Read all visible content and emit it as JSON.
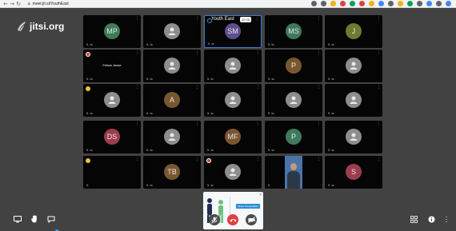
{
  "browser": {
    "url": "meet.jit.si/YouthEast",
    "nav": {
      "back": "←",
      "forward": "→",
      "reload": "↻"
    },
    "lock_icon": "lock-icon",
    "extension_colors": [
      "#5f6368",
      "#5f6368",
      "#f4b400",
      "#db4437",
      "#0f9d58",
      "#db4437",
      "#f4b400",
      "#4285f4",
      "#5f6368",
      "#f4b400",
      "#0f9d58",
      "#5f6368",
      "#4285f4",
      "#5f6368",
      "#4285f4"
    ]
  },
  "logo": {
    "text": "jitsi.org",
    "icon": "jitsi-logo"
  },
  "meeting": {
    "subject": "Youth East",
    "timer": "20 05"
  },
  "colors": {
    "green": "#3e7a5c",
    "purple": "#5f4d8e",
    "brown": "#7a5630",
    "red_avatar": "#9c3d4e",
    "olive": "#6f7a30",
    "grey": "#8d8d8d",
    "accent": "#3a7bd5",
    "hangup": "#e04040"
  },
  "tiles": [
    {
      "row": 0,
      "col": 0,
      "avatar": "MP",
      "color": "#3e7a5c",
      "signal": "5. la"
    },
    {
      "row": 0,
      "col": 1,
      "avatar": "",
      "color": "#8d8d8d",
      "signal": "5. la"
    },
    {
      "row": 0,
      "col": 2,
      "avatar": "SM",
      "color": "#5f4d8e",
      "signal": "5. la",
      "active": true
    },
    {
      "row": 0,
      "col": 3,
      "avatar": "MS",
      "color": "#3e7a5c",
      "signal": "5. la"
    },
    {
      "row": 0,
      "col": 4,
      "avatar": "J",
      "color": "#6f7a30",
      "signal": "5. la"
    },
    {
      "row": 1,
      "col": 0,
      "avatar": "",
      "color": "",
      "name": "Fellow Jesse",
      "signal": "5. la",
      "moderator": "red"
    },
    {
      "row": 1,
      "col": 1,
      "avatar": "",
      "color": "#8d8d8d",
      "signal": "5. la"
    },
    {
      "row": 1,
      "col": 2,
      "avatar": "",
      "color": "#8d8d8d",
      "signal": "5. la"
    },
    {
      "row": 1,
      "col": 3,
      "avatar": "P",
      "color": "#7a5630",
      "signal": "5. la"
    },
    {
      "row": 1,
      "col": 4,
      "avatar": "",
      "color": "#8d8d8d",
      "signal": "5. la"
    },
    {
      "row": 2,
      "col": 0,
      "avatar": "",
      "color": "#8d8d8d",
      "signal": "5. la",
      "moderator": "yellow"
    },
    {
      "row": 2,
      "col": 1,
      "avatar": "A",
      "color": "#7a5630",
      "signal": "5. la"
    },
    {
      "row": 2,
      "col": 2,
      "avatar": "",
      "color": "#8d8d8d",
      "signal": "5. la"
    },
    {
      "row": 2,
      "col": 3,
      "avatar": "",
      "color": "#8d8d8d",
      "signal": "5. la"
    },
    {
      "row": 2,
      "col": 4,
      "avatar": "",
      "color": "#8d8d8d",
      "signal": "5. la"
    },
    {
      "row": 3,
      "col": 0,
      "avatar": "DS",
      "color": "#9c3d4e",
      "signal": "5. la"
    },
    {
      "row": 3,
      "col": 1,
      "avatar": "",
      "color": "#8d8d8d",
      "signal": "5. la"
    },
    {
      "row": 3,
      "col": 2,
      "avatar": "MF",
      "color": "#7a5630",
      "signal": "5. la"
    },
    {
      "row": 3,
      "col": 3,
      "avatar": "P",
      "color": "#3e7a5c",
      "signal": "5. la"
    },
    {
      "row": 3,
      "col": 4,
      "avatar": "",
      "color": "#8d8d8d",
      "signal": "5. la"
    },
    {
      "row": 4,
      "col": 0,
      "avatar": "",
      "color": "",
      "signal": "5.",
      "moderator": "yellow"
    },
    {
      "row": 4,
      "col": 1,
      "avatar": "TB",
      "color": "#7a5630",
      "signal": "5. la"
    },
    {
      "row": 4,
      "col": 2,
      "avatar": "",
      "color": "#8d8d8d",
      "signal": "5. la",
      "moderator": "red"
    },
    {
      "row": 4,
      "col": 3,
      "avatar": "",
      "color": "",
      "signal": "5.",
      "webcam": true
    },
    {
      "row": 4,
      "col": 4,
      "avatar": "S",
      "color": "#9c3d4e",
      "signal": "5. la"
    }
  ],
  "share": {
    "label": "Share Presentation",
    "close": "×"
  },
  "toolbar": {
    "left": [
      "desktop-share-icon",
      "raise-hand-icon",
      "chat-icon"
    ],
    "chat_badge": "3",
    "center": [
      "microphone-muted-icon",
      "hangup-icon",
      "camera-muted-icon"
    ],
    "right": [
      "tile-view-icon",
      "info-icon",
      "more-options-icon"
    ],
    "more_glyph": "⋮"
  }
}
